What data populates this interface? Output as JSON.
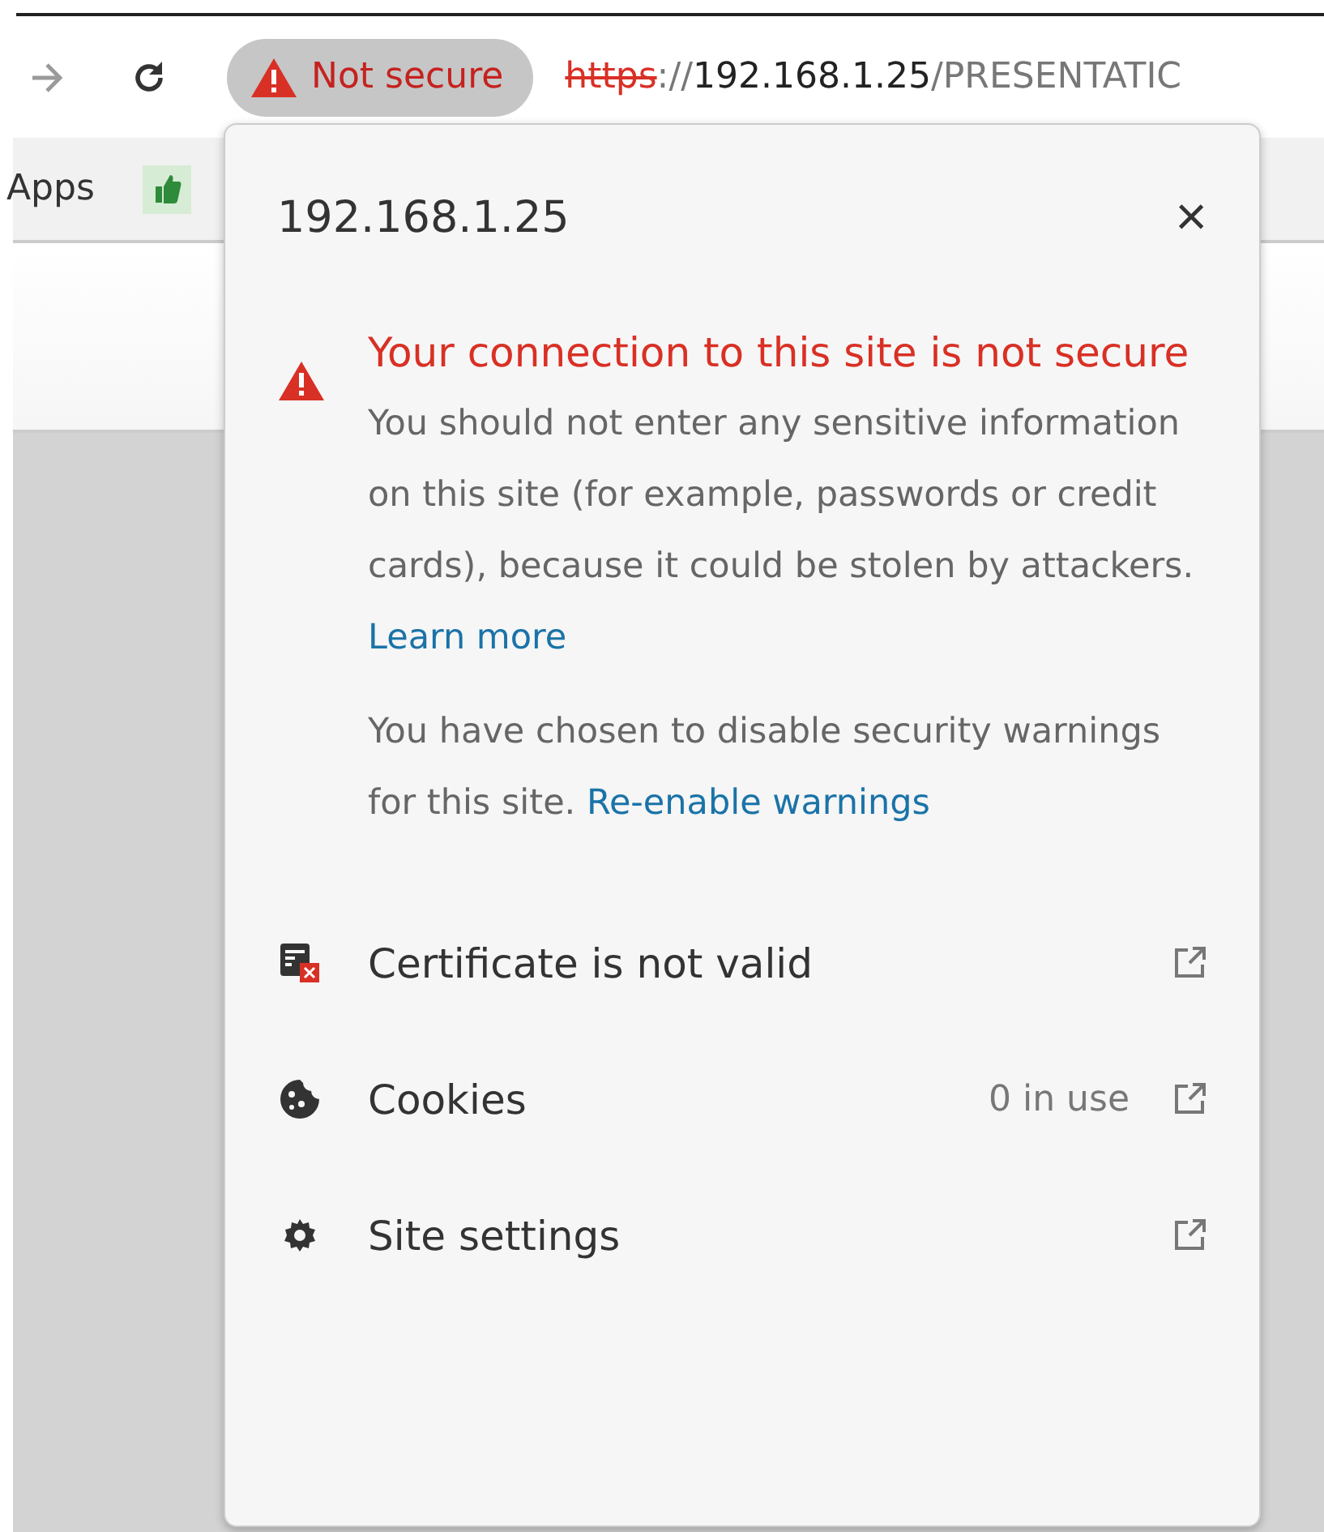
{
  "toolbar": {
    "security_chip": {
      "label": "Not secure"
    },
    "url": {
      "scheme": "https",
      "separator": "://",
      "host": "192.168.1.25",
      "path": "/PRESENTATIC"
    }
  },
  "bookmarks": [
    {
      "label": "Apps"
    }
  ],
  "popup": {
    "title": "192.168.1.25",
    "close": "×",
    "warning": {
      "heading": "Your connection to this site is not secure",
      "body": "You should not enter any sensitive information on this site (for example, passwords or credit cards), because it could be stolen by attackers.",
      "link": "Learn more"
    },
    "notice": {
      "body": "You have chosen to disable security warnings for this site.",
      "link": "Re-enable warnings"
    },
    "rows": [
      {
        "kind": "certificate",
        "label": "Certificate is not valid"
      },
      {
        "kind": "cookies",
        "label": "Cookies",
        "detail": "0 in use"
      },
      {
        "kind": "settings",
        "label": "Site settings"
      }
    ]
  }
}
